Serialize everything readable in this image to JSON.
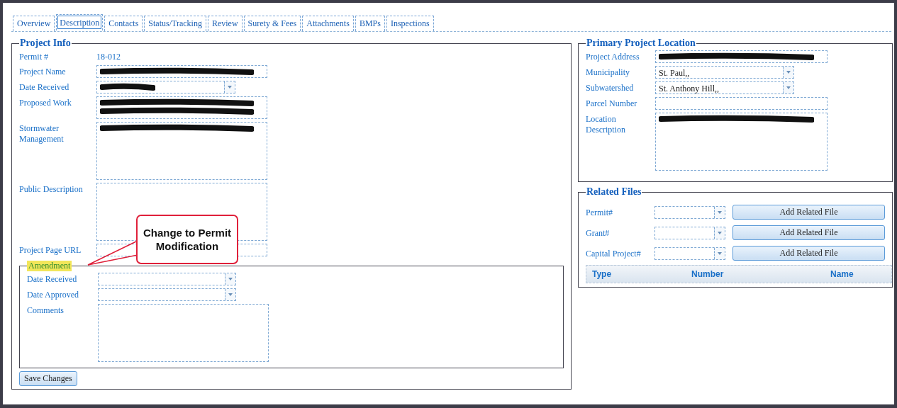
{
  "tabs": [
    {
      "label": "Overview",
      "selected": false
    },
    {
      "label": "Description",
      "selected": true
    },
    {
      "label": "Contacts",
      "selected": false
    },
    {
      "label": "Status/Tracking",
      "selected": false
    },
    {
      "label": "Review",
      "selected": false
    },
    {
      "label": "Surety & Fees",
      "selected": false
    },
    {
      "label": "Attachments",
      "selected": false
    },
    {
      "label": "BMPs",
      "selected": false
    },
    {
      "label": "Inspections",
      "selected": false
    }
  ],
  "project_info": {
    "title": "Project Info",
    "fields": [
      {
        "label": "Permit #",
        "kind": "text",
        "value": "18-012"
      },
      {
        "label": "Project Name",
        "kind": "input",
        "redacted": true
      },
      {
        "label": "Date Received",
        "kind": "select",
        "redacted": true
      },
      {
        "label": "Proposed Work",
        "kind": "memo",
        "redacted": true
      },
      {
        "label": "Stormwater Management",
        "kind": "textarea",
        "redacted": true
      },
      {
        "label": "Public Description",
        "kind": "textarea",
        "redacted": false
      },
      {
        "label": "Project Page URL",
        "kind": "input",
        "redacted": false
      }
    ]
  },
  "amendment": {
    "title": "Amendment",
    "highlighted": true,
    "fields": [
      {
        "label": "Date Received",
        "kind": "select",
        "redacted": false
      },
      {
        "label": "Date Approved",
        "kind": "select",
        "redacted": false
      },
      {
        "label": "Comments",
        "kind": "textarea",
        "redacted": false
      }
    ]
  },
  "save_button": "Save Changes",
  "callout": "Change to Permit Modification",
  "primary_location": {
    "title": "Primary Project Location",
    "fields": [
      {
        "label": "Project Address",
        "kind": "input",
        "redacted": true
      },
      {
        "label": "Municipality",
        "kind": "select",
        "value": "St. Paul,,"
      },
      {
        "label": "Subwatershed",
        "kind": "select",
        "value": "St. Anthony Hill,,"
      },
      {
        "label": "Parcel Number",
        "kind": "input",
        "redacted": false
      },
      {
        "label": "Location Description",
        "kind": "textarea",
        "redacted": true
      }
    ]
  },
  "related_files": {
    "title": "Related Files",
    "rows": [
      {
        "label": "Permit#",
        "button": "Add Related File"
      },
      {
        "label": "Grant#",
        "button": "Add Related File"
      },
      {
        "label": "Capital Project#",
        "button": "Add Related File"
      }
    ],
    "columns": [
      "Type",
      "Number",
      "Name"
    ]
  }
}
